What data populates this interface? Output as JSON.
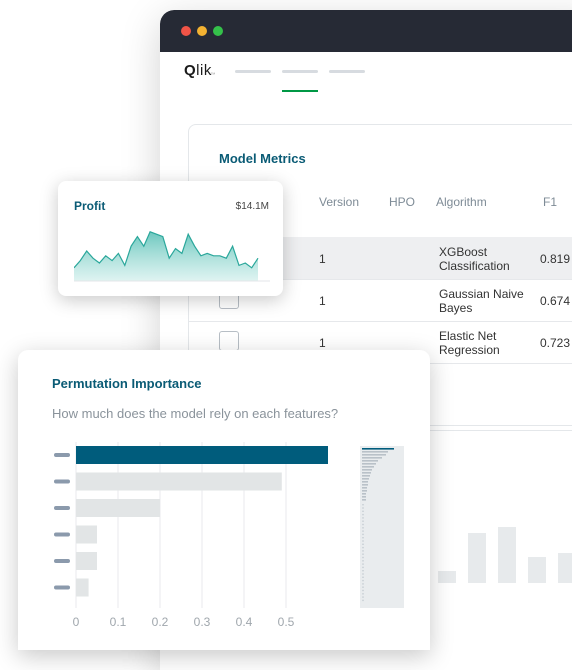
{
  "app": {
    "logo_text": "Qlik",
    "logo_first": "Q",
    "logo_rest": "lik",
    "logo_tm": "™",
    "nav_items": 3,
    "active_nav": 2
  },
  "colors": {
    "titlebar": "#262a35",
    "accent": "#0a5b75",
    "bar_primary": "#005c7c",
    "bar_secondary": "#e2e5e6",
    "nav_active": "#009845",
    "area_fill": "#7ecdc6"
  },
  "metrics": {
    "title": "Model Metrics",
    "columns": [
      "Version",
      "HPO",
      "Algorithm",
      "F1"
    ],
    "rows": [
      {
        "version": "1",
        "algorithm_l1": "XGBoost",
        "algorithm_l2": "Classification",
        "f1": "0.819",
        "selected": true
      },
      {
        "version": "1",
        "algorithm_l1": "Gaussian Naive",
        "algorithm_l2": "Bayes",
        "f1": "0.674",
        "selected": false
      },
      {
        "version": "1",
        "algorithm_l1": "Elastic Net",
        "algorithm_l2": "Regression",
        "f1": "0.723",
        "selected": false
      }
    ]
  },
  "profit": {
    "title": "Profit",
    "value": "$14.1M",
    "series": [
      3,
      6,
      10,
      7,
      5,
      8,
      6,
      9,
      4,
      12,
      16,
      12,
      18,
      17,
      16,
      7,
      11,
      9,
      17,
      12,
      8,
      9,
      8,
      8,
      7,
      12,
      4,
      5,
      3,
      7
    ]
  },
  "permutation": {
    "title": "Permutation Importance",
    "subtitle": "How much does the model rely on each features?"
  },
  "chart_data": {
    "type": "bar",
    "orientation": "horizontal",
    "title": "Permutation Importance",
    "values": [
      0.6,
      0.49,
      0.2,
      0.05,
      0.05,
      0.03
    ],
    "highlight_index": 0,
    "xlim": [
      0,
      0.65
    ],
    "xticks": [
      "0",
      "0.1",
      "0.2",
      "0.3",
      "0.4",
      "0.5"
    ],
    "grid": true
  }
}
